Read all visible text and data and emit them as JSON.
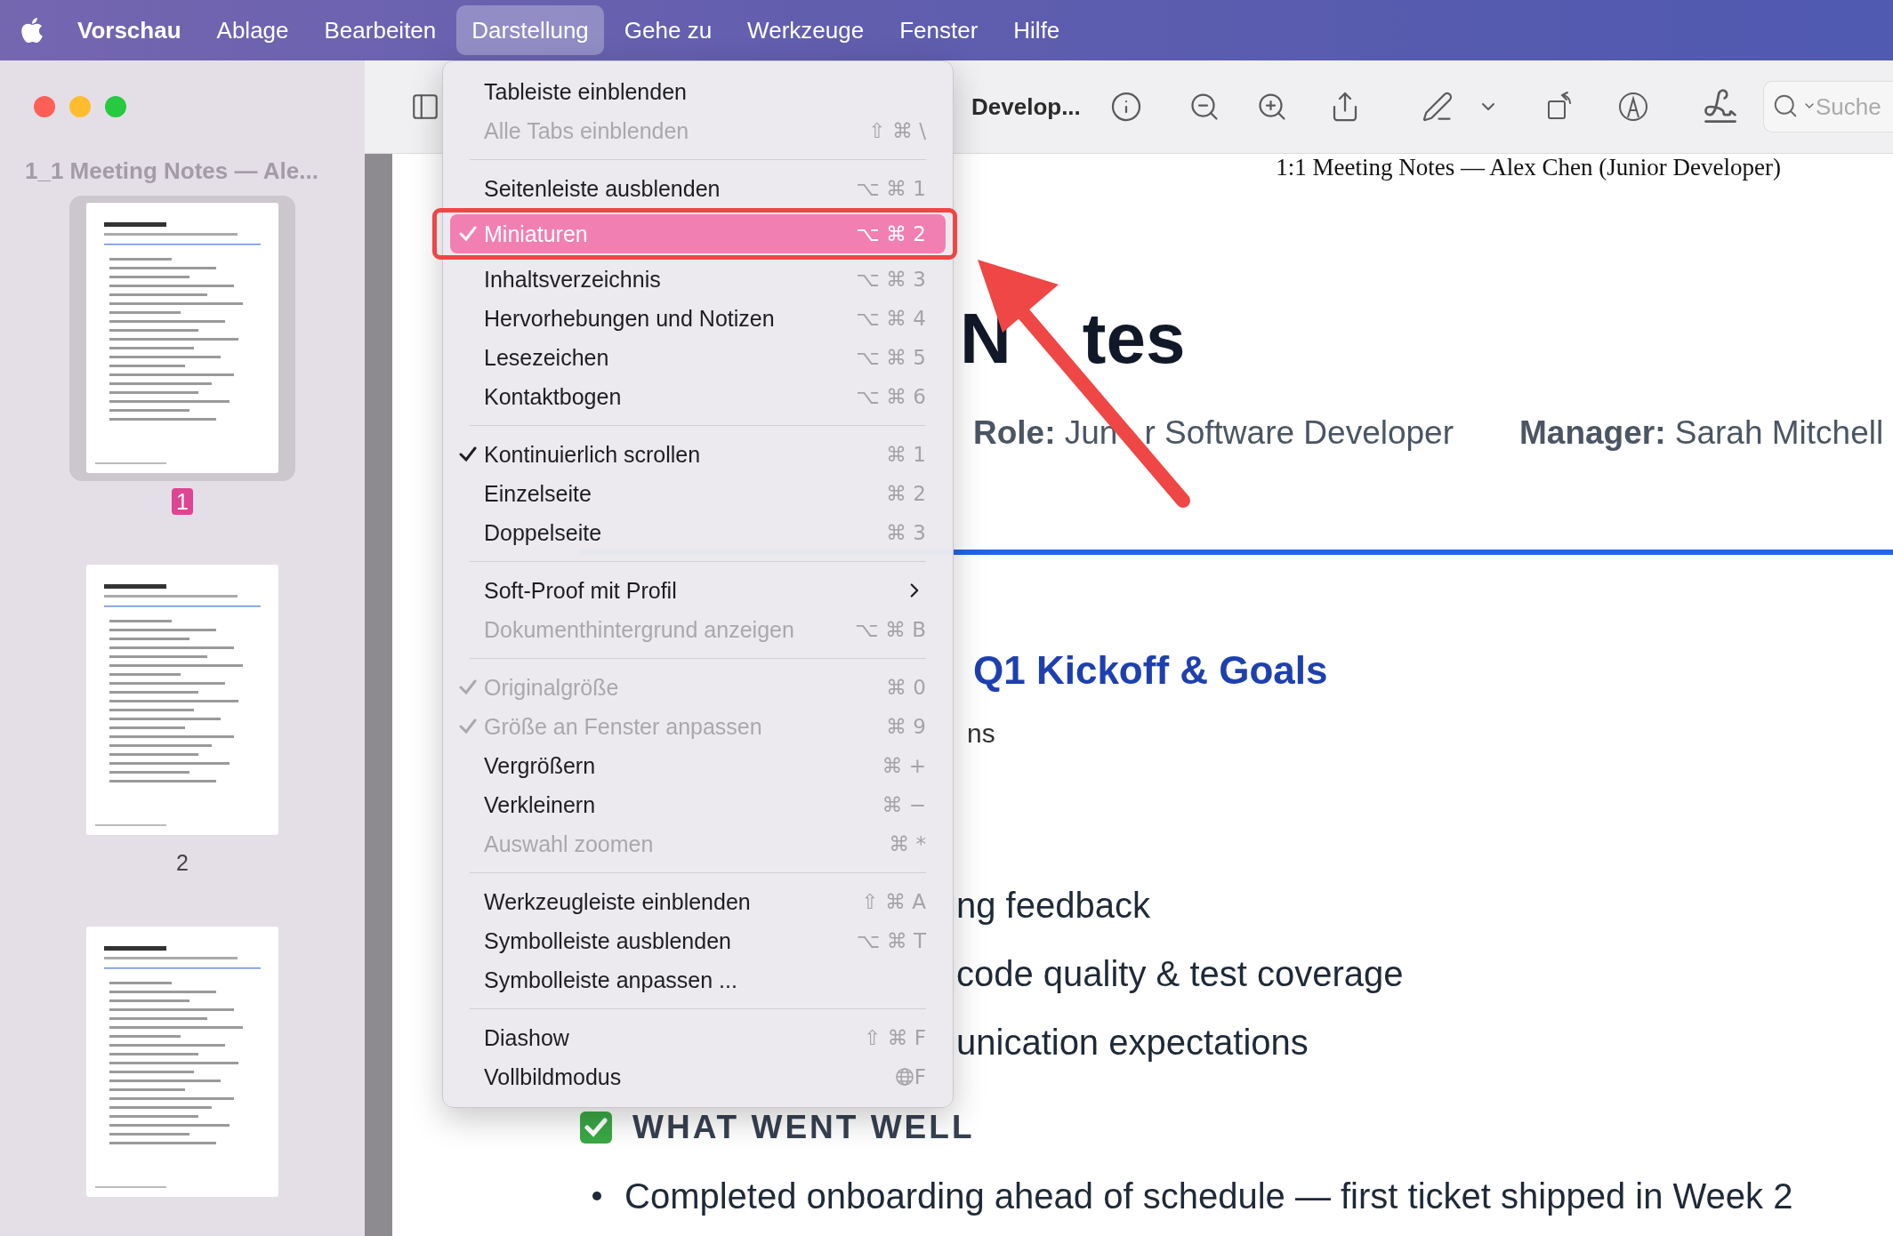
{
  "menu_bar": {
    "app_name": "Vorschau",
    "items": [
      {
        "label": "Ablage",
        "selected": false
      },
      {
        "label": "Bearbeiten",
        "selected": false
      },
      {
        "label": "Darstellung",
        "selected": true
      },
      {
        "label": "Gehe zu",
        "selected": false
      },
      {
        "label": "Werkzeuge",
        "selected": false
      },
      {
        "label": "Fenster",
        "selected": false
      },
      {
        "label": "Hilfe",
        "selected": false
      }
    ]
  },
  "sidebar": {
    "title": "1_1 Meeting Notes — Ale...",
    "thumbnails": [
      {
        "label": "1",
        "selected": true
      },
      {
        "label": "2",
        "selected": false
      },
      {
        "selected": false
      }
    ]
  },
  "toolbar": {
    "window_title": "Develop...",
    "search": {
      "placeholder": "Suche"
    }
  },
  "view_menu": {
    "sections": [
      {
        "items": [
          {
            "kind": "item",
            "label": "Tableiste einblenden",
            "checked": false,
            "disabled": false,
            "selected": false
          },
          {
            "kind": "item",
            "label": "Alle Tabs einblenden",
            "shortcut": "⇧ ⌘ \\",
            "checked": false,
            "disabled": true,
            "selected": false
          }
        ]
      },
      {
        "items": [
          {
            "kind": "item",
            "label": "Seitenleiste ausblenden",
            "shortcut": "⌥ ⌘ 1",
            "checked": false,
            "disabled": false,
            "selected": false
          },
          {
            "kind": "item",
            "label": "Miniaturen",
            "shortcut": "⌥ ⌘ 2",
            "checked": true,
            "disabled": false,
            "selected": true
          },
          {
            "kind": "item",
            "label": "Inhaltsverzeichnis",
            "shortcut": "⌥ ⌘ 3",
            "checked": false,
            "disabled": false,
            "selected": false
          },
          {
            "kind": "item",
            "label": "Hervorhebungen und Notizen",
            "shortcut": "⌥ ⌘ 4",
            "checked": false,
            "disabled": false,
            "selected": false
          },
          {
            "kind": "item",
            "label": "Lesezeichen",
            "shortcut": "⌥ ⌘ 5",
            "checked": false,
            "disabled": false,
            "selected": false
          },
          {
            "kind": "item",
            "label": "Kontaktbogen",
            "shortcut": "⌥ ⌘ 6",
            "checked": false,
            "disabled": false,
            "selected": false
          }
        ]
      },
      {
        "items": [
          {
            "kind": "item",
            "label": "Kontinuierlich scrollen",
            "shortcut": "⌘ 1",
            "checked": true,
            "disabled": false,
            "selected": false
          },
          {
            "kind": "item",
            "label": "Einzelseite",
            "shortcut": "⌘ 2",
            "checked": false,
            "disabled": false,
            "selected": false
          },
          {
            "kind": "item",
            "label": "Doppelseite",
            "shortcut": "⌘ 3",
            "checked": false,
            "disabled": false,
            "selected": false
          }
        ]
      },
      {
        "items": [
          {
            "kind": "submenu",
            "label": "Soft-Proof mit Profil",
            "checked": false,
            "disabled": false,
            "selected": false
          },
          {
            "kind": "item",
            "label": "Dokumenthintergrund anzeigen",
            "shortcut": "⌥ ⌘ B",
            "checked": false,
            "disabled": true,
            "selected": false
          }
        ]
      },
      {
        "items": [
          {
            "kind": "item",
            "label": "Originalgröße",
            "shortcut": "⌘ 0",
            "checked": true,
            "disabled": true,
            "selected": false
          },
          {
            "kind": "item",
            "label": "Größe an Fenster anpassen",
            "shortcut": "⌘ 9",
            "checked": true,
            "disabled": true,
            "selected": false
          },
          {
            "kind": "item",
            "label": "Vergrößern",
            "shortcut": "⌘ +",
            "checked": false,
            "disabled": false,
            "selected": false
          },
          {
            "kind": "item",
            "label": "Verkleinern",
            "shortcut": "⌘ −",
            "checked": false,
            "disabled": false,
            "selected": false
          },
          {
            "kind": "item",
            "label": "Auswahl zoomen",
            "shortcut": "⌘ *",
            "checked": false,
            "disabled": true,
            "selected": false
          }
        ]
      },
      {
        "items": [
          {
            "kind": "item",
            "label": "Werkzeugleiste einblenden",
            "shortcut": "⇧ ⌘ A",
            "checked": false,
            "disabled": false,
            "selected": false
          },
          {
            "kind": "item",
            "label": "Symbolleiste ausblenden",
            "shortcut": "⌥ ⌘ T",
            "checked": false,
            "disabled": false,
            "selected": false
          },
          {
            "kind": "item",
            "label": "Symbolleiste anpassen ...",
            "checked": false,
            "disabled": false,
            "selected": false
          }
        ]
      },
      {
        "items": [
          {
            "kind": "item",
            "label": "Diashow",
            "shortcut": "⇧ ⌘ F",
            "checked": false,
            "disabled": false,
            "selected": false
          },
          {
            "kind": "item",
            "label": "Vollbildmodus",
            "globe_key": true,
            "shortcut": "F",
            "checked": false,
            "disabled": false,
            "selected": false
          }
        ]
      }
    ]
  },
  "document": {
    "running_header": "1:1 Meeting Notes — Alex Chen (Junior Developer)",
    "title": "N",
    "title_tail": "tes",
    "meta": [
      {
        "label": "Role:",
        "value": "Jun",
        "value_tail": "r Software Developer"
      },
      {
        "label": "Manager:",
        "value": "Sarah Mitchell"
      }
    ],
    "section_heading": "Q1 Kickoff & Goals",
    "date_fragment": "ns",
    "agenda_fragments": [
      "ng feedback",
      "code quality & test coverage",
      "unication expectations"
    ],
    "subheading": "WHAT WENT WELL",
    "bullets": [
      "Completed onboarding ahead of schedule — first ticket shipped in Week 2"
    ]
  }
}
